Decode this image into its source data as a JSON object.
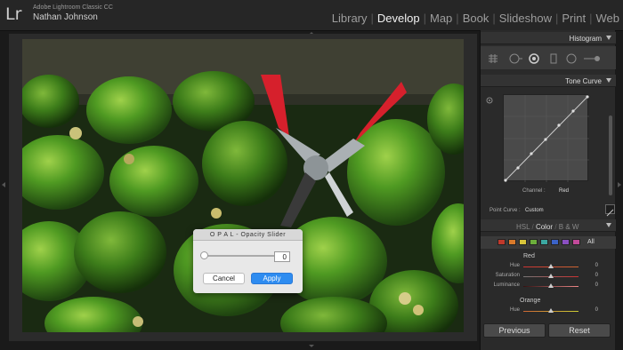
{
  "app": {
    "logo": "Lr",
    "product_name": "Adobe Lightroom Classic CC",
    "user_name": "Nathan Johnson"
  },
  "modules": [
    "Library",
    "Develop",
    "Map",
    "Book",
    "Slideshow",
    "Print",
    "Web"
  ],
  "active_module": "Develop",
  "dialog": {
    "title": "O P A L - Opacity Slider",
    "slider_value": "0",
    "cancel_label": "Cancel",
    "apply_label": "Apply"
  },
  "panel": {
    "histogram_title": "Histogram",
    "tone_curve_title": "Tone Curve",
    "channel_label": "Channel :",
    "channel_value": "Red",
    "point_curve_label": "Point Curve :",
    "point_curve_value": "Custom",
    "hsl_tabs": [
      "HSL",
      "Color",
      "B & W"
    ],
    "hsl_active": "Color",
    "all_label": "All",
    "swatch_colors": [
      "#c0392b",
      "#d97a2b",
      "#d8c43a",
      "#6cae3b",
      "#3ba7a1",
      "#3b63c7",
      "#8a4fc1",
      "#c24a9a"
    ],
    "groups": [
      {
        "title": "Red",
        "sliders": [
          {
            "label": "Hue",
            "value": "0"
          },
          {
            "label": "Saturation",
            "value": "0"
          },
          {
            "label": "Luminance",
            "value": "0"
          }
        ]
      },
      {
        "title": "Orange",
        "sliders": [
          {
            "label": "Hue",
            "value": "0"
          }
        ]
      }
    ],
    "previous_label": "Previous",
    "reset_label": "Reset"
  }
}
